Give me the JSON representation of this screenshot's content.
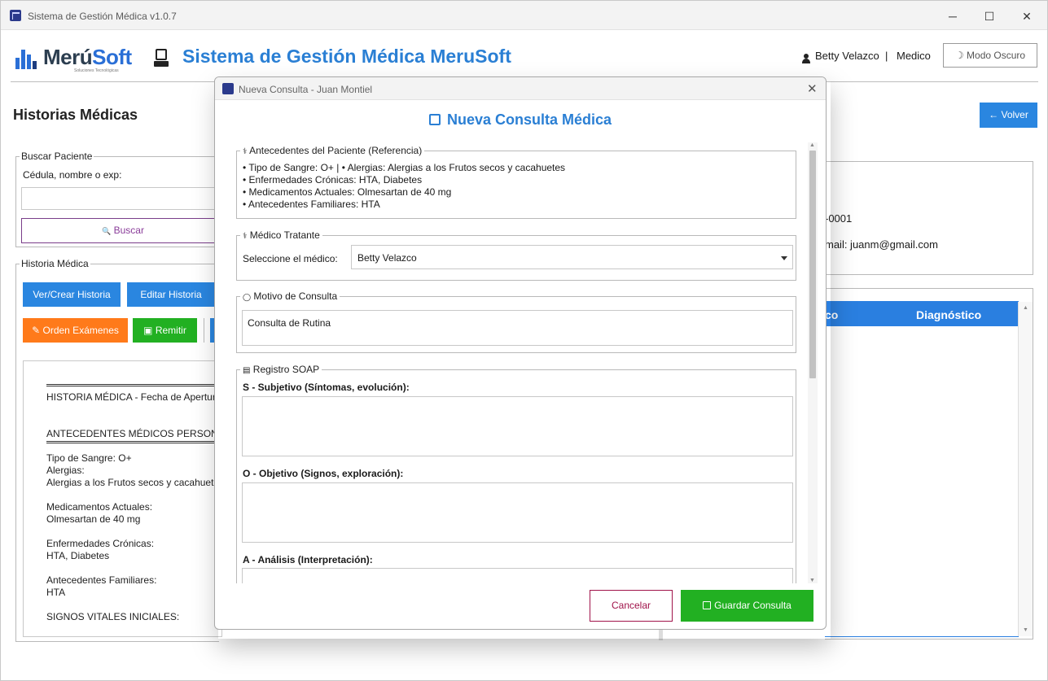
{
  "window": {
    "title": "Sistema de Gestión Médica v1.0.7",
    "min_glyph": "─",
    "max_glyph": "☐",
    "close_glyph": "✕"
  },
  "header": {
    "logo_word_a": "Merú",
    "logo_word_b": "Soft",
    "logo_tagline": "Soluciones Tecnológicas",
    "app_title": "Sistema de Gestión Médica MeruSoft",
    "user_name": "Betty Velazco",
    "separator": "|",
    "user_role": "Medico",
    "dark_mode_label": "Modo Oscuro",
    "dark_mode_glyph": "☽"
  },
  "page": {
    "title": "Historias Médicas",
    "back_label": "← Volver"
  },
  "search": {
    "legend": "Buscar Paciente",
    "label": "Cédula, nombre o exp:",
    "input_value": "",
    "button_label": "Buscar",
    "button_glyph": "🔍"
  },
  "history": {
    "legend": "Historia Médica",
    "buttons": {
      "view_create": "Ver/Crear Historia",
      "edit": "Editar Historia",
      "exams": "Orden Exámenes",
      "exams_glyph": "✎",
      "refer": "Remitir",
      "refer_glyph": "▣"
    },
    "text_lines": [
      "HISTORIA MÉDICA - Fecha de Apertura:",
      "ANTECEDENTES MÉDICOS PERSONALES",
      "Tipo de Sangre: O+",
      "Alergias:",
      "Alergias a los Frutos secos y cacahuetes",
      "Medicamentos Actuales:",
      "Olmesartan de 40 mg",
      "Enfermedades Crónicas:",
      "HTA, Diabetes",
      "Antecedentes Familiares:",
      "HTA",
      "SIGNOS VITALES INICIALES:"
    ]
  },
  "patient_info": {
    "line1": "-0001",
    "line2": "mail: juanm@gmail.com"
  },
  "consultas_table": {
    "col_partial": "co",
    "col_diagnostico": "Diagnóstico"
  },
  "modal": {
    "title": "Nueva Consulta - Juan Montiel",
    "close_glyph": "✕",
    "heading": "Nueva Consulta Médica",
    "antecedentes": {
      "legend": "Antecedentes del Paciente (Referencia)",
      "legend_glyph": "⚕",
      "line1": "• Tipo de Sangre: O+   |   • Alergias: Alergias a los Frutos secos y cacahuetes",
      "line2": "• Enfermedades Crónicas: HTA, Diabetes",
      "line3": "• Medicamentos Actuales: Olmesartan de 40 mg",
      "line4": "• Antecedentes Familiares: HTA"
    },
    "medico": {
      "legend": "Médico Tratante",
      "legend_glyph": "⚕",
      "label": "Seleccione el médico:",
      "selected": "Betty Velazco"
    },
    "motivo": {
      "legend": "Motivo de Consulta",
      "legend_glyph": "◯",
      "value": "Consulta de Rutina"
    },
    "soap": {
      "legend": "Registro SOAP",
      "legend_glyph": "▤",
      "s_label": "S - Subjetivo (Síntomas, evolución):",
      "s_value": "",
      "o_label": "O - Objetivo (Signos, exploración):",
      "o_value": "",
      "a_label": "A - Análisis (Interpretación):",
      "a_value": ""
    },
    "cancel_label": "Cancelar",
    "save_label": "Guardar Consulta"
  },
  "colors": {
    "accent_blue": "#2a7fd4",
    "button_blue": "#2a86e0",
    "orange": "#ff7a1a",
    "green": "#22b022",
    "cancel_red": "#a0134a",
    "search_purple": "#8a3d9a"
  }
}
